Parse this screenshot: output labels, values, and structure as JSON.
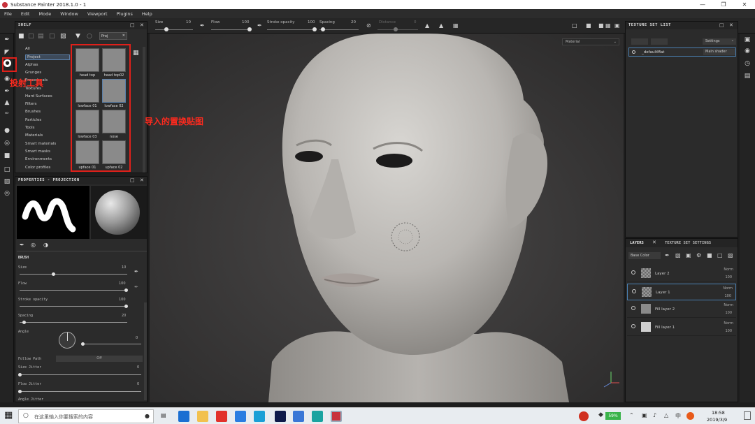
{
  "window": {
    "title": "Substance Painter 2018.1.0 - 1"
  },
  "menu": [
    "File",
    "Edit",
    "Mode",
    "Window",
    "Viewport",
    "Plugins",
    "Help"
  ],
  "toolbar": {
    "size_label": "Size",
    "size_value": "10",
    "flow_label": "Flow",
    "flow_value": "100",
    "stroke_label": "Stroke opacity",
    "stroke_value": "100",
    "spacing_label": "Spacing",
    "spacing_value": "20",
    "distance_label": "Distance",
    "distance_value": "0"
  },
  "shelf": {
    "title": "SHELF",
    "search": "Proj",
    "categories": [
      "All",
      "Project",
      "Alphas",
      "Grunges",
      "Procedurals",
      "Textures",
      "Hard Surfaces",
      "Filters",
      "Brushes",
      "Particles",
      "Tools",
      "Materials",
      "Smart materials",
      "Smart masks",
      "Environments",
      "Color profiles"
    ],
    "selected_category": "Project",
    "thumbnails": [
      "head top",
      "head top02",
      "lowface 01",
      "lowface 02",
      "lowface 03",
      "nose",
      "upface 01",
      "upface 02"
    ]
  },
  "properties": {
    "title": "PROPERTIES - PROJECTION",
    "section": "BRUSH",
    "size_label": "Size",
    "size_value": "10",
    "flow_label": "Flow",
    "flow_value": "100",
    "stroke_label": "Stroke opacity",
    "stroke_value": "100",
    "spacing_label": "Spacing",
    "spacing_value": "20",
    "angle_label": "Angle",
    "angle_value": "0",
    "follow_label": "Follow Path",
    "follow_value": "Off",
    "size_jitter_label": "Size Jitter",
    "size_jitter_value": "0",
    "flow_jitter_label": "Flow Jitter",
    "flow_jitter_value": "0",
    "angle_jitter_label": "Angle Jitter"
  },
  "viewport": {
    "material_dropdown": "Material"
  },
  "texture_set_list": {
    "title": "TEXTURE SET LIST",
    "settings_label": "Settings",
    "item_name": "_defaultMat",
    "item_shader": "Main shader"
  },
  "layers": {
    "tab_layers": "LAYERS",
    "tab_settings": "TEXTURE SET SETTINGS",
    "channel": "Base Color",
    "items": [
      {
        "name": "Layer 2",
        "blend": "Norm",
        "opacity": "100"
      },
      {
        "name": "Layer 1",
        "blend": "Norm",
        "opacity": "100"
      },
      {
        "name": "Fill layer 2",
        "blend": "Norm",
        "opacity": "100"
      },
      {
        "name": "Fill layer 1",
        "blend": "Norm",
        "opacity": "100"
      }
    ]
  },
  "annotations": {
    "tool_label": "投射工具",
    "texture_label": "导入的置换贴图"
  },
  "taskbar": {
    "search_placeholder": "在这里输入你要搜索的内容",
    "battery": "59%",
    "ime": "中",
    "time": "18:58",
    "date": "2019/3/9"
  },
  "colors": {
    "annotation_red": "#e0201a",
    "accent_blue": "#4a7fb0"
  }
}
